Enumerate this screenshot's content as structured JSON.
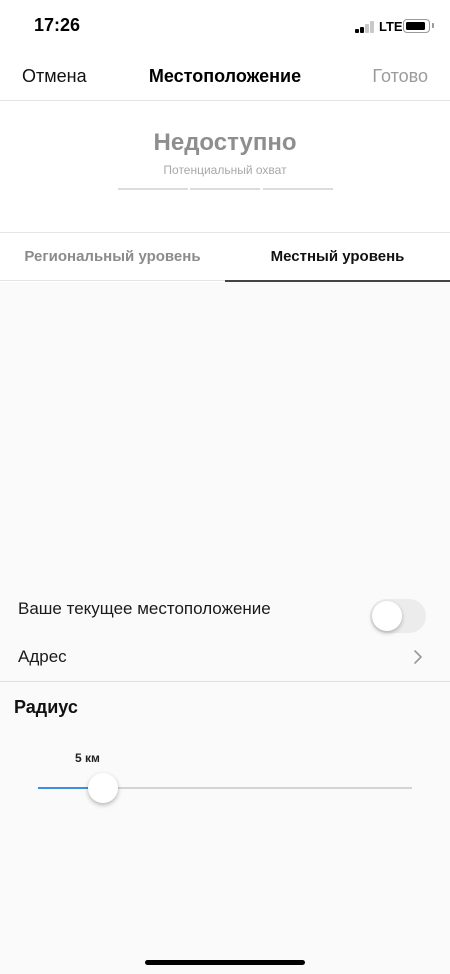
{
  "status_bar": {
    "time": "17:26",
    "network": "LTE",
    "signal_bars_filled": 2,
    "signal_bars_total": 4
  },
  "nav": {
    "cancel_label": "Отмена",
    "title": "Местоположение",
    "done_label": "Готово"
  },
  "reach": {
    "value": "Недоступно",
    "label": "Потенциальный охват"
  },
  "tabs": [
    {
      "label": "Региональный уровень",
      "selected": false
    },
    {
      "label": "Местный уровень",
      "selected": true
    }
  ],
  "settings": {
    "current_location_label": "Ваше текущее местоположение",
    "current_location_enabled": false,
    "address_label": "Адрес",
    "radius_title": "Радиус",
    "radius_value_label": "5 км",
    "radius_fraction": 0.135
  },
  "colors": {
    "accent": "#3b8fe0",
    "muted_text": "#8e8e8e",
    "divider": "#e4e4e4",
    "background": "#fafafa"
  }
}
